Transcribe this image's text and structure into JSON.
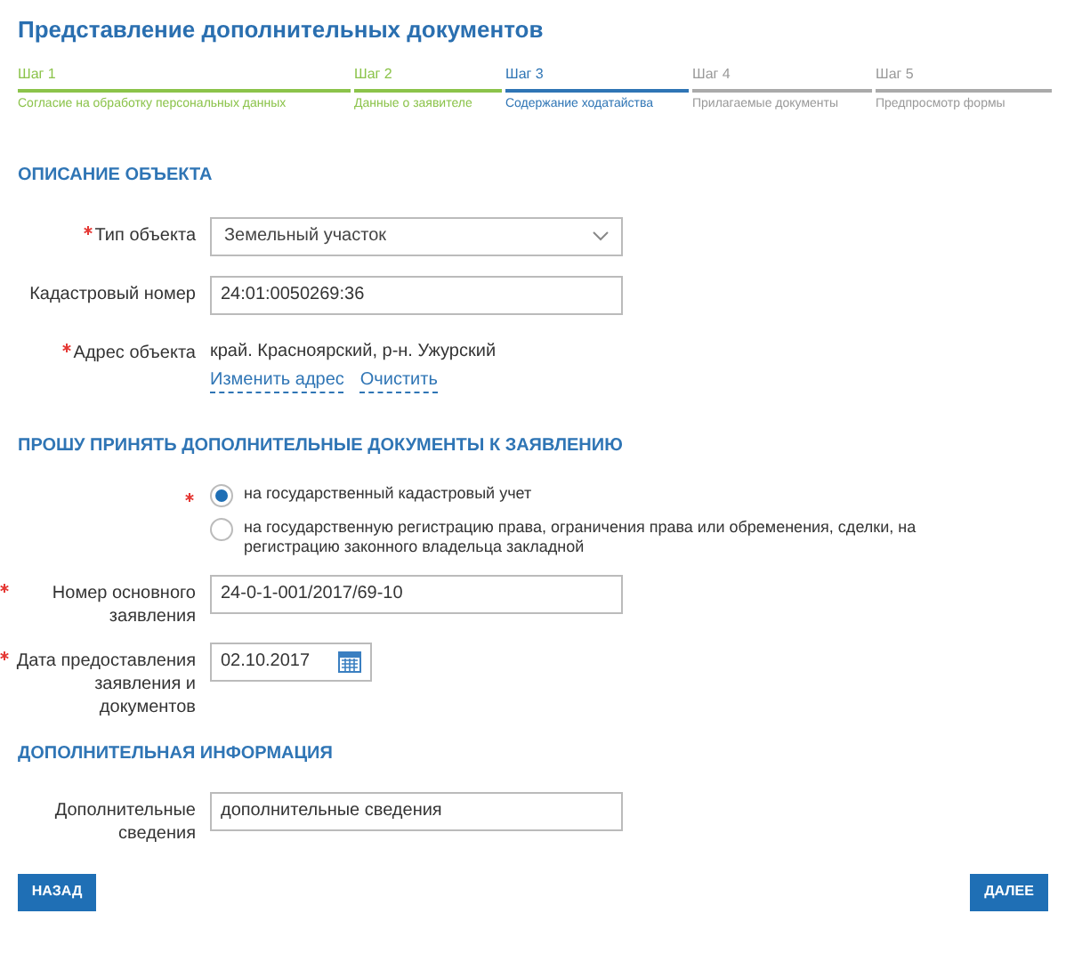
{
  "title": "Представление дополнительных документов",
  "steps": [
    {
      "step": "Шаг 1",
      "label": "Согласие на обработку персональных данных",
      "kind": "done"
    },
    {
      "step": "Шаг 2",
      "label": "Данные о заявителе",
      "kind": "done"
    },
    {
      "step": "Шаг 3",
      "label": "Содержание ходатайства",
      "kind": "current"
    },
    {
      "step": "Шаг 4",
      "label": "Прилагаемые документы",
      "kind": "todo"
    },
    {
      "step": "Шаг 5",
      "label": "Предпросмотр формы",
      "kind": "todo"
    }
  ],
  "object_section": {
    "heading": "ОПИСАНИЕ ОБЪЕКТА",
    "fields": [
      {
        "kind": "select",
        "label": "Тип объекта",
        "required": true,
        "value": "Земельный участок"
      },
      {
        "kind": "text",
        "label": "Кадастровый номер",
        "required": false,
        "value": "24:01:0050269:36"
      },
      {
        "kind": "address",
        "label": "Адрес объекта",
        "required": true,
        "value": "край. Красноярский, р-н. Ужурский",
        "links": [
          "Изменить адрес",
          "Очистить"
        ]
      }
    ]
  },
  "request_section": {
    "heading": "ПРОШУ ПРИНЯТЬ ДОПОЛНИТЕЛЬНЫЕ ДОКУМЕНТЫ К ЗАЯВЛЕНИЮ",
    "required": true,
    "options": [
      {
        "label": "на государственный кадастровый учет",
        "selected": true
      },
      {
        "label": "на государственную регистрацию права, ограничения права или обременения, сделки, на регистрацию законного владельца закладной",
        "selected": false
      }
    ],
    "fields": [
      {
        "kind": "text",
        "label": "Номер основного заявления",
        "required": true,
        "value": "24-0-1-001/2017/69-10"
      },
      {
        "kind": "date",
        "label": "Дата предоставления заявления и документов",
        "required": true,
        "value": "02.10.2017"
      }
    ]
  },
  "extra_section": {
    "heading": "ДОПОЛНИТЕЛЬНАЯ ИНФОРМАЦИЯ",
    "fields": [
      {
        "kind": "text",
        "label": "Дополнительные сведения",
        "required": false,
        "value": "дополнительные сведения"
      }
    ]
  },
  "buttons": {
    "back": "НАЗАД",
    "next": "ДАЛЕЕ"
  }
}
